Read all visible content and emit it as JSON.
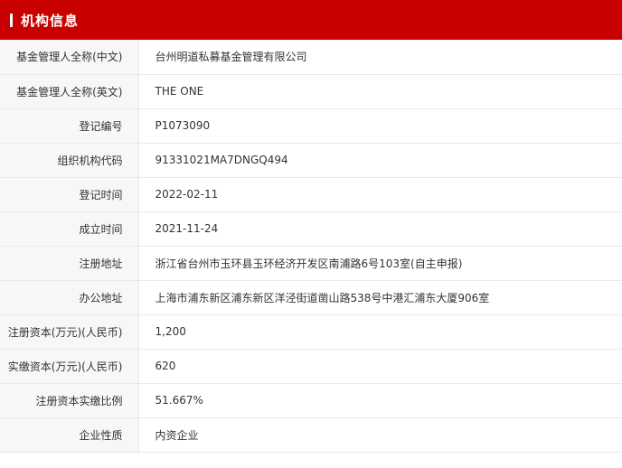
{
  "header": {
    "title": "机构信息"
  },
  "rows": [
    {
      "label": "基金管理人全称(中文)",
      "value": "台州明道私募基金管理有限公司"
    },
    {
      "label": "基金管理人全称(英文)",
      "value": "THE ONE"
    },
    {
      "label": "登记编号",
      "value": "P1073090"
    },
    {
      "label": "组织机构代码",
      "value": "91331021MA7DNGQ494"
    },
    {
      "label": "登记时间",
      "value": "2022-02-11"
    },
    {
      "label": "成立时间",
      "value": "2021-11-24"
    },
    {
      "label": "注册地址",
      "value": "浙江省台州市玉环县玉环经济开发区南浦路6号103室(自主申报)"
    },
    {
      "label": "办公地址",
      "value": "上海市浦东新区浦东新区洋泾街道凿山路538号中港汇浦东大厦906室"
    },
    {
      "label": "注册资本(万元)(人民币)",
      "value": "1,200"
    },
    {
      "label": "实缴资本(万元)(人民币)",
      "value": "620"
    },
    {
      "label": "注册资本实缴比例",
      "value": "51.667%"
    },
    {
      "label": "企业性质",
      "value": "内资企业"
    }
  ]
}
